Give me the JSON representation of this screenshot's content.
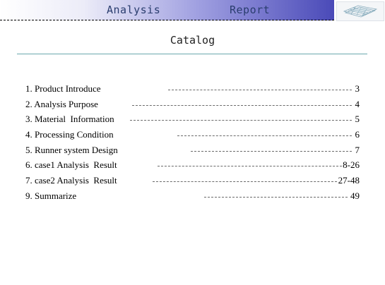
{
  "header": {
    "word1": "Analysis",
    "word2": "Report"
  },
  "logo": {
    "icon": "mold-3d-thumbnail-icon"
  },
  "catalog": {
    "title": "Catalog",
    "items": [
      {
        "label": "1. Product Introduce",
        "page": "3"
      },
      {
        "label": "2. Analysis Purpose",
        "page": "4"
      },
      {
        "label": "3. Material  Information",
        "page": "5"
      },
      {
        "label": "4. Processing Condition",
        "page": "6"
      },
      {
        "label": "5. Runner system Design",
        "page": "7"
      },
      {
        "label": "6. case1 Analysis  Result",
        "page": "8-26"
      },
      {
        "label": "7. case2 Analysis  Result",
        "page": "27-48"
      },
      {
        "label": "9. Summarize",
        "page": "49"
      }
    ]
  }
}
